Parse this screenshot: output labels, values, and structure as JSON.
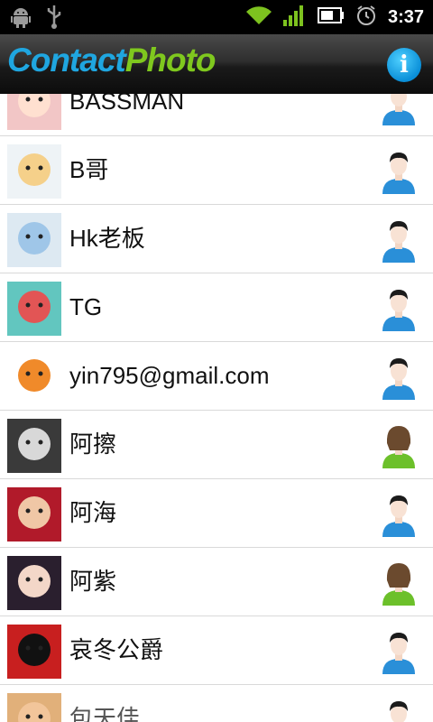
{
  "status_bar": {
    "time": "3:37",
    "icons": [
      "android-debug-icon",
      "usb-icon",
      "wifi-icon",
      "signal-icon",
      "battery-icon",
      "alarm-icon"
    ]
  },
  "header": {
    "logo_part1": "Contact",
    "logo_part2": "Photo",
    "info_label": "i"
  },
  "colors": {
    "logo_blue": "#1fa6e0",
    "logo_green": "#7fc81e",
    "info_blue": "#0a8fd8",
    "male_shirt": "#2a8fd8",
    "female_shirt": "#6cc02a"
  },
  "contacts": [
    {
      "name": "BASSMAN",
      "gender": "male"
    },
    {
      "name": "B哥",
      "gender": "male"
    },
    {
      "name": "Hk老板",
      "gender": "male"
    },
    {
      "name": "TG",
      "gender": "male"
    },
    {
      "name": "yin795@gmail.com",
      "gender": "male"
    },
    {
      "name": "阿擦",
      "gender": "female"
    },
    {
      "name": "阿海",
      "gender": "male"
    },
    {
      "name": "阿紫",
      "gender": "female"
    },
    {
      "name": "哀冬公爵",
      "gender": "male"
    },
    {
      "name": "包天佳",
      "gender": "male"
    }
  ]
}
